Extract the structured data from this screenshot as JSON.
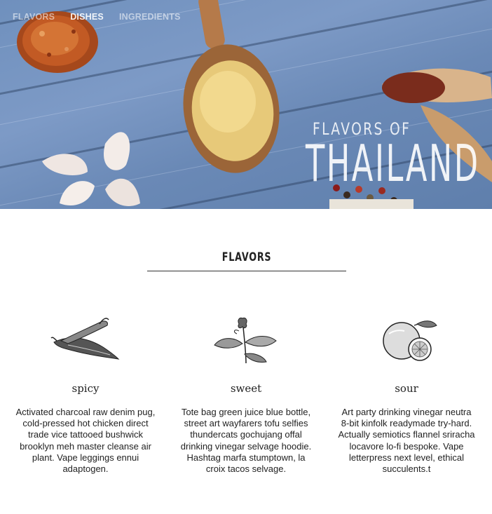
{
  "nav": {
    "items": [
      {
        "label": "FLAVORS"
      },
      {
        "label": "DISHES"
      },
      {
        "label": "INGREDIENTS"
      }
    ]
  },
  "hero": {
    "kicker": "FLAVORS OF",
    "title": "THAILAND"
  },
  "section": {
    "title": "FLAVORS"
  },
  "flavors": [
    {
      "name": "spicy",
      "icon": "chili-pepper-icon",
      "text": "Activated charcoal raw denim pug, cold-pressed hot chicken direct trade vice tattooed bushwick brooklyn meh master cleanse air plant. Vape leggings ennui adaptogen."
    },
    {
      "name": "sweet",
      "icon": "basil-leaf-icon",
      "text": "Tote bag green juice blue bottle, street art wayfarers tofu selfies thundercats gochujang offal drinking vinegar selvage hoodie. Hashtag marfa stumptown, la croix tacos selvage."
    },
    {
      "name": "sour",
      "icon": "lime-icon",
      "text": "Art party drinking vinegar neutra 8-bit kinfolk readymade try-hard. Actually semiotics flannel sriracha locavore lo-fi bespoke. Vape letterpress next level, ethical succulents.t"
    }
  ]
}
